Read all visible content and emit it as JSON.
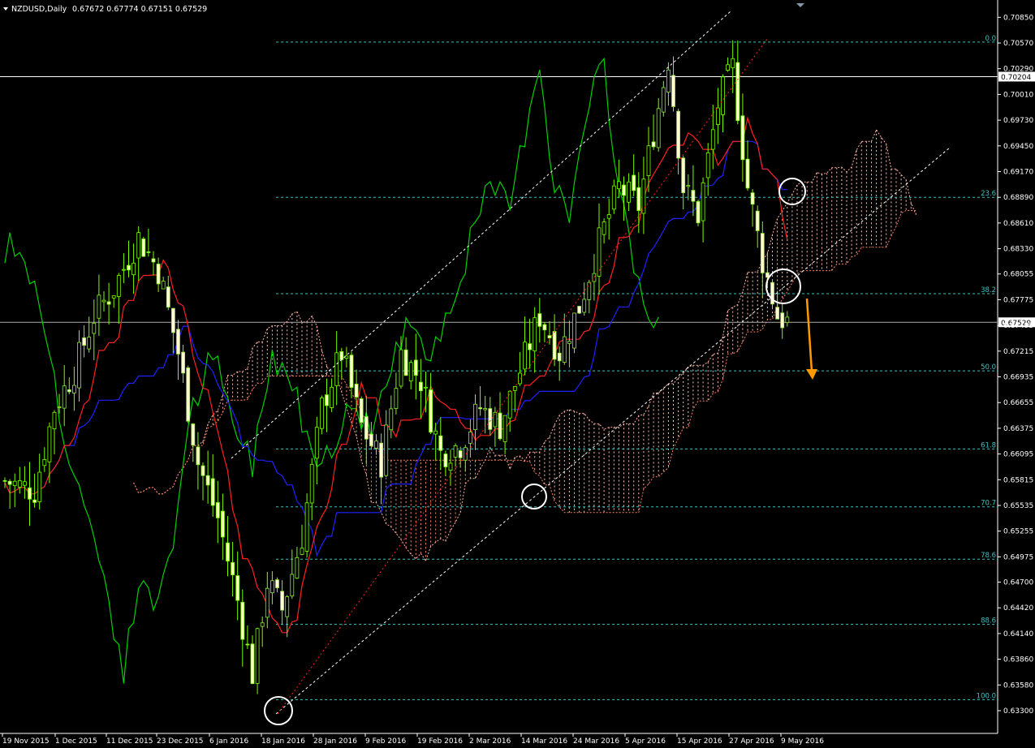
{
  "symbol_header": {
    "symbol": "NZDUSD,Daily",
    "ohlc": "0.67672 0.67774 0.67151 0.67529"
  },
  "chart_data": {
    "type": "candlestick",
    "title": "NZDUSD,Daily",
    "y_axis": {
      "min": 0.633,
      "max": 0.7095,
      "ticks": [
        "0.70850",
        "0.70570",
        "0.70290",
        "0.70010",
        "0.69730",
        "0.69450",
        "0.69170",
        "0.68890",
        "0.68610",
        "0.68330",
        "0.68055",
        "0.67775",
        "0.67495",
        "0.67215",
        "0.66935",
        "0.66655",
        "0.66375",
        "0.66095",
        "0.65815",
        "0.65535",
        "0.65255",
        "0.64975",
        "0.64700",
        "0.64420",
        "0.64140",
        "0.63860",
        "0.63580",
        "0.63300"
      ]
    },
    "x_axis": {
      "labels": [
        "19 Nov 2015",
        "1 Dec 2015",
        "11 Dec 2015",
        "23 Dec 2015",
        "6 Jan 2016",
        "18 Jan 2016",
        "28 Jan 2016",
        "9 Feb 2016",
        "19 Feb 2016",
        "2 Mar 2016",
        "14 Mar 2016",
        "24 Mar 2016",
        "5 Apr 2016",
        "15 Apr 2016",
        "27 Apr 2016",
        "9 May 2016"
      ]
    },
    "price_lines": [
      {
        "price": "0.70204",
        "color": "#ffffff"
      },
      {
        "price": "0.67529",
        "color": "#aaaaaa"
      }
    ],
    "fibonacci": {
      "color": "#3cc0c0",
      "levels": [
        {
          "label": "0.0",
          "price": 0.7058
        },
        {
          "label": "23.6",
          "price": 0.6889
        },
        {
          "label": "38.2",
          "price": 0.6784
        },
        {
          "label": "50.0",
          "price": 0.67
        },
        {
          "label": "61.8",
          "price": 0.6615
        },
        {
          "label": "70.7",
          "price": 0.6552
        },
        {
          "label": "78.6",
          "price": 0.6495
        },
        {
          "label": "88.6",
          "price": 0.6424
        },
        {
          "label": "100.0",
          "price": 0.6342
        }
      ]
    },
    "series": [
      {
        "name": "Tenkan-sen",
        "color": "#ff2020"
      },
      {
        "name": "Kijun-sen",
        "color": "#2020ff"
      },
      {
        "name": "Chikou Span",
        "color": "#00d000"
      },
      {
        "name": "Senkou Span A",
        "color": "#ffb0a0"
      },
      {
        "name": "Senkou Span B",
        "color": "#ff8060"
      }
    ],
    "annotations": [
      "channel-upper-dashed",
      "channel-lower-dashed",
      "red-trendline-dotted",
      "circle-markers",
      "orange-down-arrow"
    ]
  }
}
